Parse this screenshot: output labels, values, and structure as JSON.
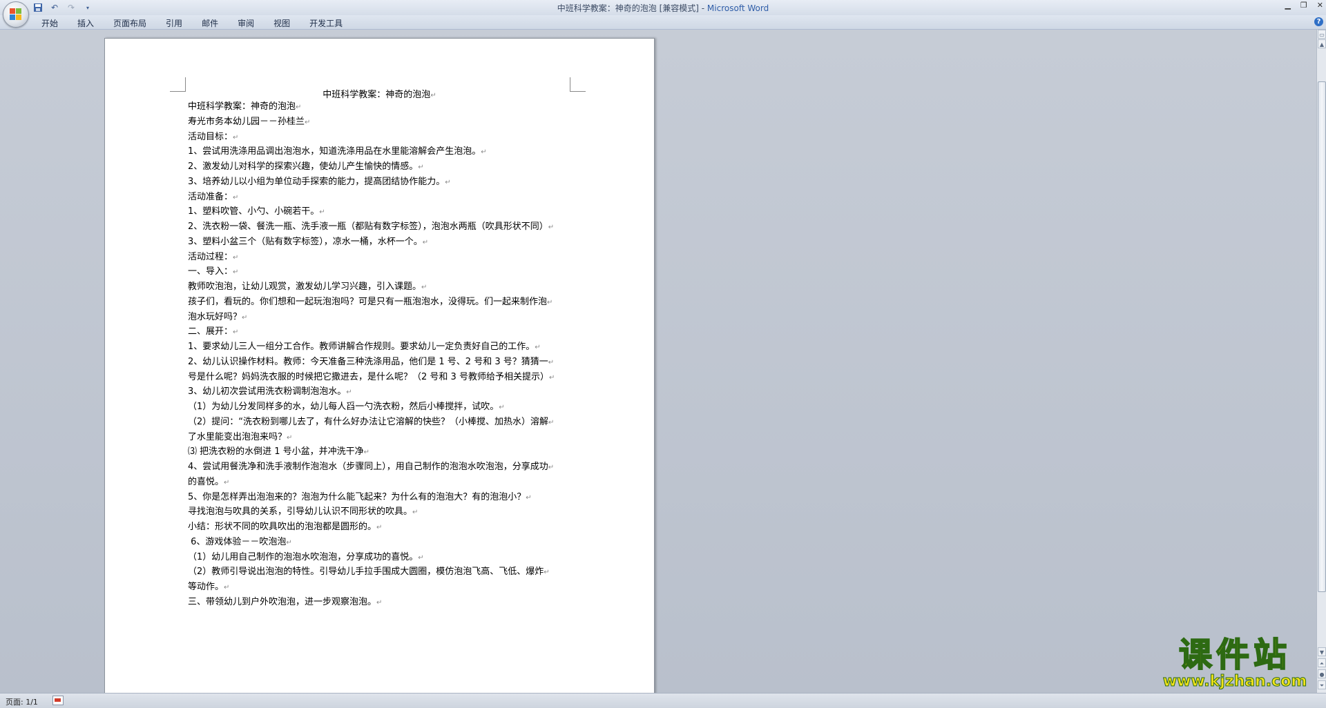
{
  "window": {
    "title": "中班科学教案：神奇的泡泡 [兼容模式] - ",
    "app_name": "Microsoft Word"
  },
  "quick_access": {
    "save_icon": "save-icon",
    "undo_icon": "undo-icon",
    "redo_icon": "redo-icon",
    "customize_icon": "dropdown-icon"
  },
  "ribbon": {
    "tabs": [
      "开始",
      "插入",
      "页面布局",
      "引用",
      "邮件",
      "审阅",
      "视图",
      "开发工具"
    ],
    "help": "?"
  },
  "document": {
    "title": "中班科学教案：神奇的泡泡",
    "lines": [
      "中班科学教案：神奇的泡泡",
      "寿光市务本幼儿园－－孙桂兰",
      "活动目标：",
      "1、尝试用洗涤用品调出泡泡水，知道洗涤用品在水里能溶解会产生泡泡。",
      "2、激发幼儿对科学的探索兴趣，使幼儿产生愉快的情感。",
      "3、培养幼儿以小组为单位动手探索的能力，提高团结协作能力。",
      "活动准备：",
      "1、塑料吹管、小勺、小碗若干。",
      "2、洗衣粉一袋、餐洗一瓶、洗手液一瓶（都贴有数字标签），泡泡水两瓶（吹具形状不同）",
      "3、塑料小盆三个（贴有数字标签），凉水一桶，水杯一个。",
      "活动过程：",
      "一、导入：",
      "教师吹泡泡，让幼儿观赏，激发幼儿学习兴趣，引入课题。",
      "孩子们，看玩的。你们想和一起玩泡泡吗？可是只有一瓶泡泡水，没得玩。们一起来制作泡",
      "泡水玩好吗？",
      "二、展开：",
      "1、要求幼儿三人一组分工合作。教师讲解合作规则。要求幼儿一定负责好自己的工作。",
      "2、幼儿认识操作材料。教师：今天准备三种洗涤用品，他们是 1 号、2 号和 3 号？猜猜一",
      "号是什么呢？妈妈洗衣服的时候把它撒进去，是什么呢？（2 号和 3 号教师给予相关提示）",
      "3、幼儿初次尝试用洗衣粉调制泡泡水。",
      "（1）为幼儿分发同样多的水，幼儿每人舀一勺洗衣粉，然后小棒搅拌，试吹。",
      "（2）提问：“洗衣粉到哪儿去了，有什么好办法让它溶解的快些？（小棒搅、加热水）溶解",
      "了水里能变出泡泡来吗？",
      "⑶ 把洗衣粉的水倒进 1 号小盆，并冲洗干净",
      "4、尝试用餐洗净和洗手液制作泡泡水（步骤同上），用自己制作的泡泡水吹泡泡，分享成功",
      "的喜悦。",
      "5、你是怎样弄出泡泡来的？泡泡为什么能飞起来？为什么有的泡泡大？有的泡泡小？",
      "寻找泡泡与吹具的关系，引导幼儿认识不同形状的吹具。",
      "小结：形状不同的吹具吹出的泡泡都是圆形的。",
      " 6、游戏体验－－吹泡泡",
      "（1）幼儿用自己制作的泡泡水吹泡泡，分享成功的喜悦。",
      "（2）教师引导说出泡泡的特性。引导幼儿手拉手围成大圆圈，模仿泡泡飞高、飞低、爆炸",
      "等动作。",
      "三、带领幼儿到户外吹泡泡，进一步观察泡泡。"
    ],
    "paragraph_mark": "↵"
  },
  "status_bar": {
    "page": "页面: 1/1"
  },
  "watermark": {
    "main": "课件站",
    "url": "www.kjzhan.com"
  },
  "colors": {
    "title_app": "#2f5da8",
    "watermark_fill": "#f2e31a",
    "watermark_stroke": "#2d6a12"
  }
}
